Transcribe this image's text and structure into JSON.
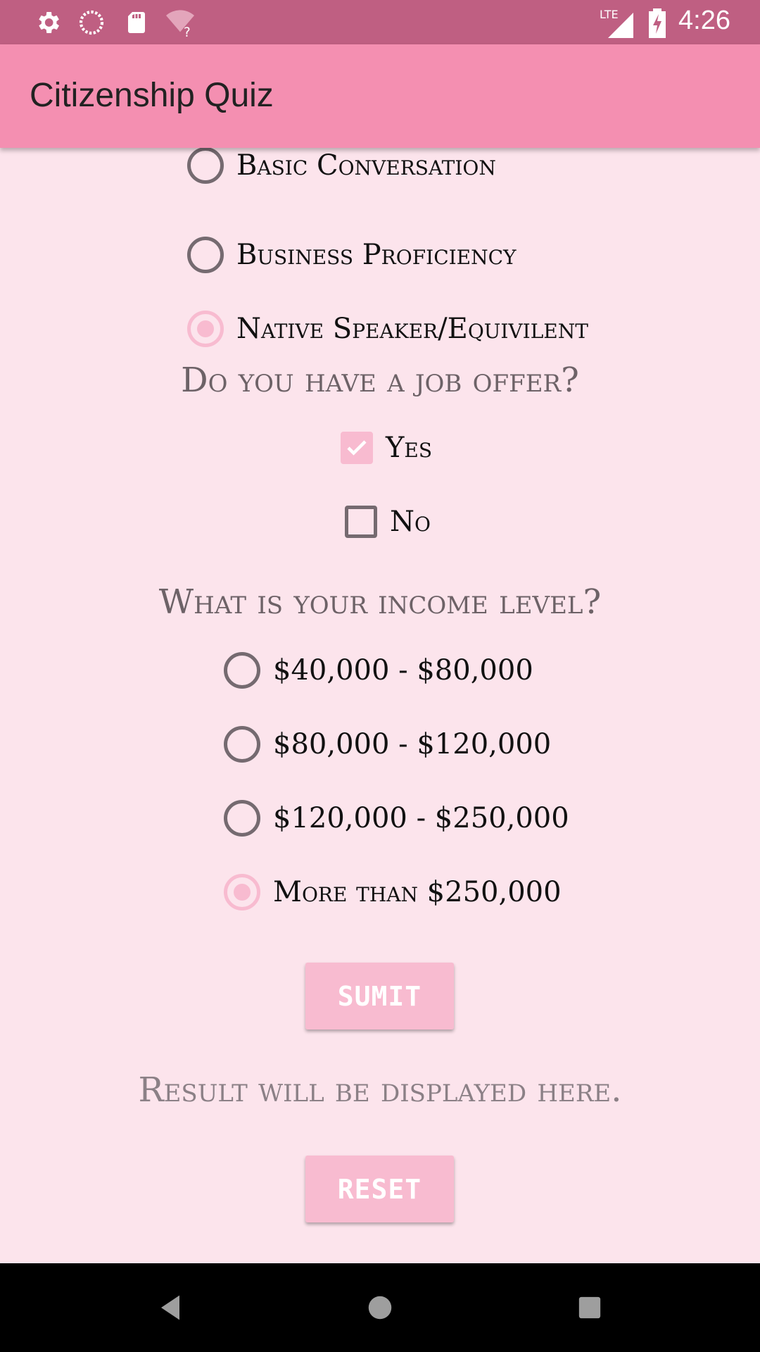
{
  "status_bar": {
    "time": "4:26",
    "network": "LTE"
  },
  "app_bar": {
    "title": "Citizenship Quiz"
  },
  "language": {
    "options": [
      {
        "label": "Basic Conversation",
        "selected": false
      },
      {
        "label": "Business Proficiency",
        "selected": false
      },
      {
        "label": "Native Speaker/Equivilent",
        "selected": true
      }
    ]
  },
  "job": {
    "question": "Do you have a job offer?",
    "options": [
      {
        "label": "Yes",
        "checked": true
      },
      {
        "label": "No",
        "checked": false
      }
    ]
  },
  "income": {
    "question": "What is your income level?",
    "options": [
      {
        "label": "$40,000 - $80,000",
        "selected": false
      },
      {
        "label": "$80,000 - $120,000",
        "selected": false
      },
      {
        "label": "$120,000 - $250,000",
        "selected": false
      },
      {
        "label": "More than $250,000",
        "selected": true
      }
    ]
  },
  "buttons": {
    "submit": "SUMIT",
    "reset": "RESET"
  },
  "result": {
    "text": "Result will be displayed here."
  },
  "colors": {
    "status_bar": "#bf5f82",
    "app_bar": "#f48fb1",
    "background": "#fce4ec",
    "accent": "#f8bbd0"
  },
  "icons": [
    "settings-icon",
    "sync-icon",
    "sd-card-icon",
    "wifi-unknown-icon",
    "signal-icon",
    "battery-charging-icon",
    "back-icon",
    "home-icon",
    "recents-icon"
  ]
}
